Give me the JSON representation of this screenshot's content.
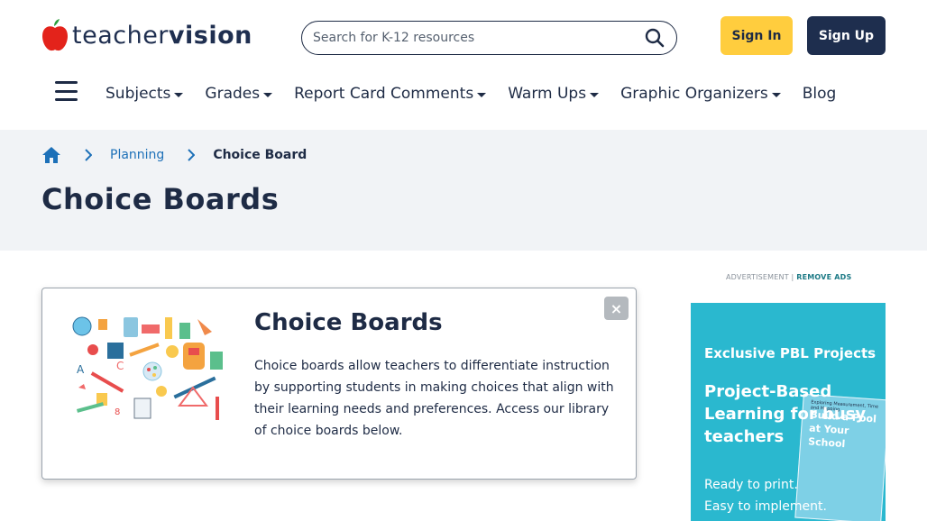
{
  "header": {
    "logo_part1": "teacher",
    "logo_part2": "vision",
    "search_placeholder": "Search for K-12 resources",
    "sign_in": "Sign In",
    "sign_up": "Sign Up"
  },
  "nav": {
    "items": [
      {
        "label": "Subjects",
        "dropdown": true
      },
      {
        "label": "Grades",
        "dropdown": true
      },
      {
        "label": "Report Card Comments",
        "dropdown": true
      },
      {
        "label": "Warm Ups",
        "dropdown": true
      },
      {
        "label": "Graphic Organizers",
        "dropdown": true
      },
      {
        "label": "Blog",
        "dropdown": false
      }
    ]
  },
  "breadcrumb": {
    "items": [
      "Planning"
    ],
    "current": "Choice Board"
  },
  "page": {
    "title": "Choice Boards"
  },
  "card": {
    "title": "Choice Boards",
    "description": "Choice boards allow teachers to differentiate instruction by supporting students in making choices that align with their learning needs and preferences. Access our library of choice boards below.",
    "close": "×"
  },
  "ad": {
    "label": "ADVERTISEMENT |",
    "remove": "REMOVE ADS",
    "kicker": "Exclusive PBL Projects",
    "headline": "Project-Based Learning for busy teachers",
    "body_line1": "Ready to print.",
    "body_line2": "Easy to implement.",
    "book_title": "Build a Pool at Your School",
    "book_subtitle": "Exploring Measurement, Time and Mapping"
  },
  "colors": {
    "navy": "#1e2b45",
    "signin_yellow": "#ffcd3e",
    "signup_navy": "#1e2e4e",
    "link_blue": "#1d70b8",
    "band_gray": "#f1f3f6",
    "ad_teal": "#2ab8cf"
  }
}
